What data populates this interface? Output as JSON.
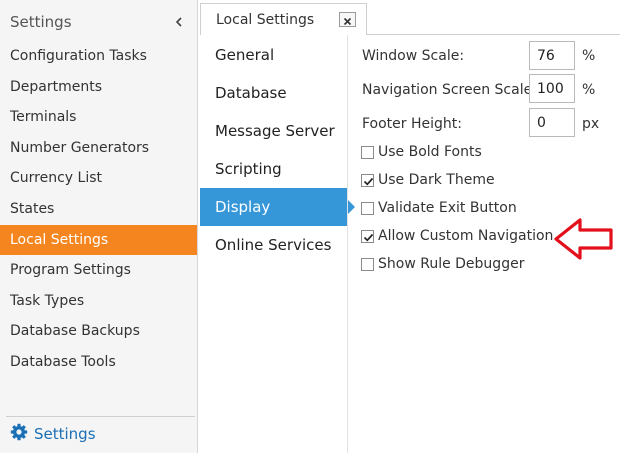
{
  "sidebar": {
    "title": "Settings",
    "collapse_icon": "chevron-left-icon",
    "items": [
      {
        "label": "Configuration Tasks"
      },
      {
        "label": "Departments"
      },
      {
        "label": "Terminals"
      },
      {
        "label": "Number Generators"
      },
      {
        "label": "Currency List"
      },
      {
        "label": "States"
      },
      {
        "label": "Local Settings",
        "active": true
      },
      {
        "label": "Program Settings"
      },
      {
        "label": "Task Types"
      },
      {
        "label": "Database Backups"
      },
      {
        "label": "Database Tools"
      }
    ],
    "footer": {
      "label": "Settings",
      "icon": "gear-icon"
    }
  },
  "tab": {
    "label": "Local Settings",
    "close_icon": "close-icon"
  },
  "categories": [
    {
      "label": "General"
    },
    {
      "label": "Database"
    },
    {
      "label": "Message Server"
    },
    {
      "label": "Scripting"
    },
    {
      "label": "Display",
      "active": true
    },
    {
      "label": "Online Services"
    }
  ],
  "display": {
    "window_scale": {
      "label": "Window Scale:",
      "value": "76",
      "unit": "%"
    },
    "nav_scale": {
      "label": "Navigation Screen Scale:",
      "value": "100",
      "unit": "%"
    },
    "footer_height": {
      "label": "Footer Height:",
      "value": "0",
      "unit": "px"
    },
    "options": [
      {
        "label": "Use Bold Fonts",
        "checked": false
      },
      {
        "label": "Use Dark Theme",
        "checked": true
      },
      {
        "label": "Validate Exit Button",
        "checked": false
      },
      {
        "label": "Allow Custom Navigation",
        "checked": true
      },
      {
        "label": "Show Rule Debugger",
        "checked": false
      }
    ]
  },
  "annotation": {
    "icon": "red-arrow-icon",
    "color": "#e3101c"
  },
  "colors": {
    "sidebar_active": "#f5861f",
    "category_active": "#3597d8",
    "footer_link": "#1b6fb5"
  }
}
